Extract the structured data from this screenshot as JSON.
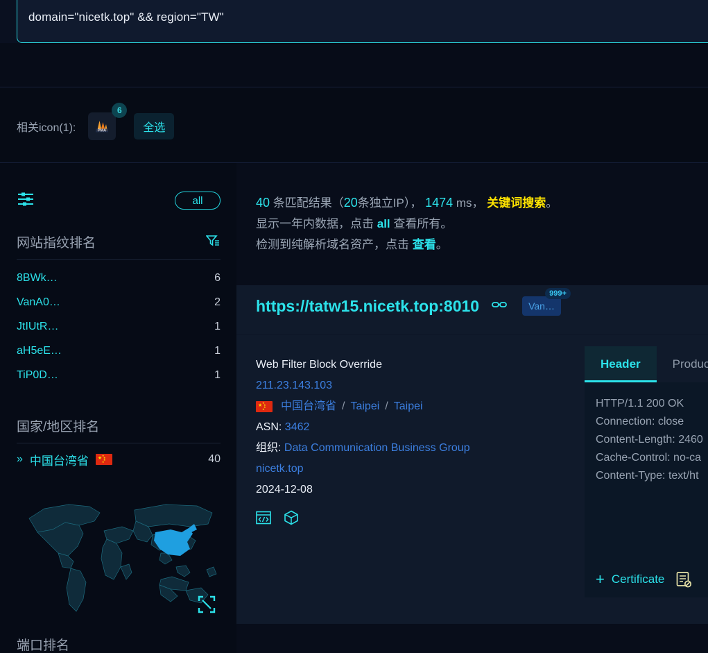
{
  "search": {
    "query": "domain=\"nicetk.top\" && region=\"TW\""
  },
  "icon_row": {
    "label": "相关icon(1):",
    "favicon_name": "phpmyadmin-icon",
    "favicon_badge": "6",
    "select_all_label": "全选"
  },
  "sidebar": {
    "filter_icon": "sliders-icon",
    "all_label": "all",
    "fingerprint": {
      "title": "网站指纹排名",
      "filter_icon": "funnel-icon",
      "rows": [
        {
          "name": "8BWk…",
          "count": "6"
        },
        {
          "name": "VanA0…",
          "count": "2"
        },
        {
          "name": "JtIUtR…",
          "count": "1"
        },
        {
          "name": "aH5eE…",
          "count": "1"
        },
        {
          "name": "TiP0D…",
          "count": "1"
        }
      ]
    },
    "country": {
      "title": "国家/地区排名",
      "rows": [
        {
          "name": "中国台湾省",
          "flag": "cn-flag",
          "count": "40"
        }
      ]
    },
    "map": {
      "highlight_region": "China",
      "highlight_color": "#1f9fe0",
      "expand_icon": "fullscreen-icon"
    },
    "port": {
      "title": "端口排名"
    }
  },
  "summary": {
    "line1": {
      "count": "40",
      "text_a": "条匹配结果（",
      "unique": "20",
      "text_b": "条独立IP），",
      "ms": "1474",
      "text_c": "ms，",
      "highlight": "关键词搜索",
      "text_d": "。"
    },
    "line2": {
      "text_a": "显示一年内数据，点击",
      "link": "all",
      "text_b": "查看所有。"
    },
    "line3": {
      "text_a": "检测到纯解析域名资产，点击",
      "link": "查看",
      "text_b": "。"
    }
  },
  "result": {
    "url": "https://tatw15.nicetk.top:8010",
    "link_icon": "chain-link-icon",
    "tag": "Van…",
    "tag_badge": "999+",
    "title": "Web Filter Block Override",
    "ip": "211.23.143.103",
    "region": "中国台湾省",
    "city": "Taipei",
    "district": "Taipei",
    "separator": "/",
    "asn_label": "ASN:",
    "asn": "3462",
    "org_label": "组织:",
    "org": "Data Communication Business Group",
    "domain": "nicetk.top",
    "date": "2024-12-08",
    "action_icons": [
      "code-window-icon",
      "cube-icon"
    ]
  },
  "header_panel": {
    "tabs": [
      {
        "label": "Header",
        "active": true
      },
      {
        "label": "Product",
        "active": false
      }
    ],
    "content": "HTTP/1.1 200 OK\nConnection: close\nContent-Length: 2460\nCache-Control: no-ca\nContent-Type: text/ht",
    "certificate_label": "Certificate",
    "certificate_plus": "+",
    "certificate_icon": "document-blocked-icon"
  }
}
